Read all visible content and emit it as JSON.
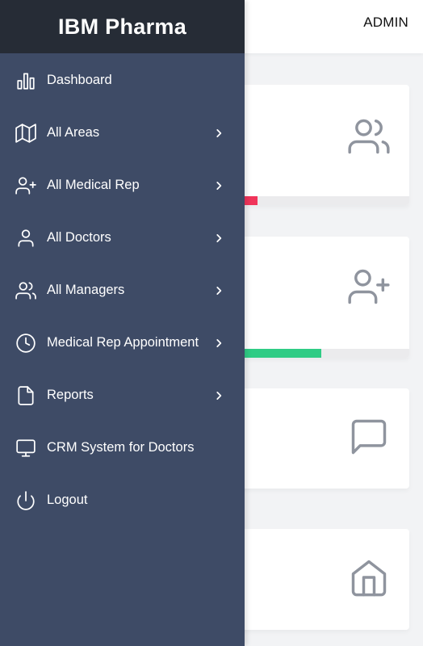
{
  "app": {
    "brand": "IBM Pharma",
    "user_label": "ADMIN"
  },
  "colors": {
    "drawer_bg": "#3e4b66",
    "drawer_header_bg": "#262c36",
    "progress_red": "#f0345a",
    "progress_green": "#2fcc85",
    "card_icon": "#8f949e"
  },
  "menu": {
    "items": [
      {
        "label": "Dashboard",
        "icon": "bar-chart-icon",
        "has_submenu": false
      },
      {
        "label": "All Areas",
        "icon": "map-icon",
        "has_submenu": true
      },
      {
        "label": "All Medical Rep",
        "icon": "user-plus-icon",
        "has_submenu": true
      },
      {
        "label": "All Doctors",
        "icon": "user-icon",
        "has_submenu": true
      },
      {
        "label": "All Managers",
        "icon": "users-icon",
        "has_submenu": true
      },
      {
        "label": "Medical Rep Appointment",
        "icon": "clock-icon",
        "has_submenu": true
      },
      {
        "label": "Reports",
        "icon": "file-icon",
        "has_submenu": true
      },
      {
        "label": "CRM System for Doctors",
        "icon": "monitor-icon",
        "has_submenu": false
      },
      {
        "label": "Logout",
        "icon": "power-icon",
        "has_submenu": false
      }
    ]
  },
  "cards": [
    {
      "icon": "users-icon",
      "progress_percent": 63,
      "progress_color": "red"
    },
    {
      "icon": "user-plus-icon",
      "progress_percent": 78.5,
      "progress_color": "green"
    },
    {
      "icon": "message-square-icon"
    },
    {
      "icon": "home-icon"
    }
  ]
}
